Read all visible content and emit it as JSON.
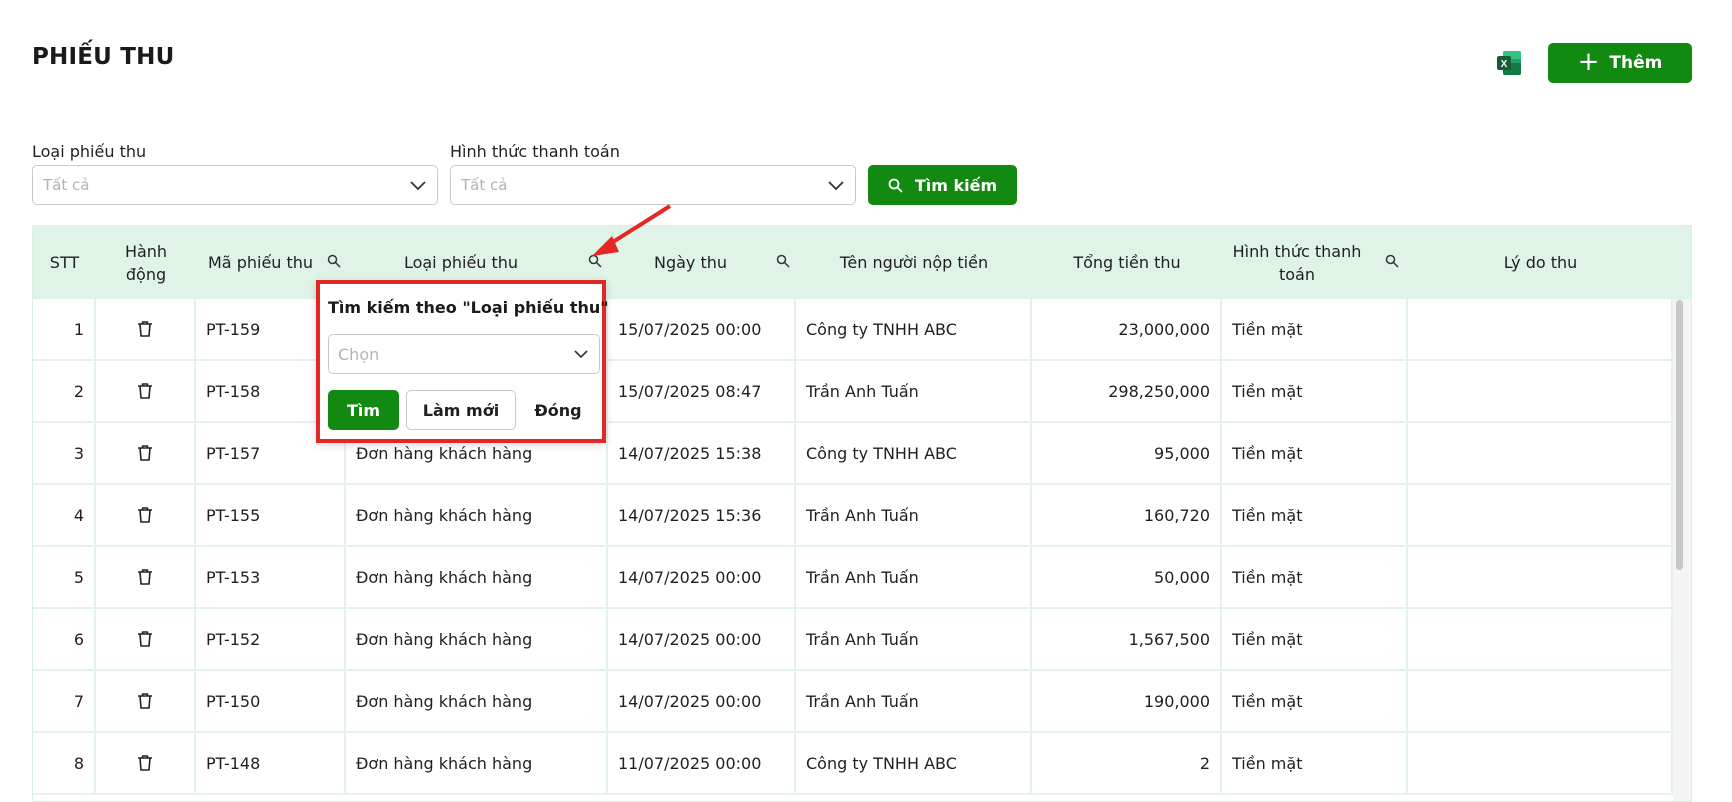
{
  "page": {
    "title": "PHIẾU THU"
  },
  "toolbar": {
    "add_label": "Thêm",
    "excel_icon": "excel-icon"
  },
  "filters": {
    "type_label": "Loại phiếu thu",
    "type_placeholder": "Tất cả",
    "payment_label": "Hình thức thanh toán",
    "payment_placeholder": "Tất cả",
    "search_label": "Tìm kiếm"
  },
  "table": {
    "headers": {
      "stt": "STT",
      "action": "Hành động",
      "code": "Mã phiếu thu",
      "type": "Loại phiếu thu",
      "date": "Ngày thu",
      "payer": "Tên người nộp tiền",
      "total": "Tổng tiền thu",
      "payment": "Hình thức thanh toán",
      "reason": "Lý do thu"
    },
    "rows": [
      {
        "stt": "1",
        "code": "PT-159",
        "type": "",
        "date": "15/07/2025 00:00",
        "payer": "Công ty TNHH ABC",
        "total": "23,000,000",
        "payment": "Tiền mặt",
        "reason": ""
      },
      {
        "stt": "2",
        "code": "PT-158",
        "type": "",
        "date": "15/07/2025 08:47",
        "payer": "Trần Anh Tuấn",
        "total": "298,250,000",
        "payment": "Tiền mặt",
        "reason": ""
      },
      {
        "stt": "3",
        "code": "PT-157",
        "type": "Đơn hàng khách hàng",
        "date": "14/07/2025 15:38",
        "payer": "Công ty TNHH ABC",
        "total": "95,000",
        "payment": "Tiền mặt",
        "reason": ""
      },
      {
        "stt": "4",
        "code": "PT-155",
        "type": "Đơn hàng khách hàng",
        "date": "14/07/2025 15:36",
        "payer": "Trần Anh Tuấn",
        "total": "160,720",
        "payment": "Tiền mặt",
        "reason": ""
      },
      {
        "stt": "5",
        "code": "PT-153",
        "type": "Đơn hàng khách hàng",
        "date": "14/07/2025 00:00",
        "payer": "Trần Anh Tuấn",
        "total": "50,000",
        "payment": "Tiền mặt",
        "reason": ""
      },
      {
        "stt": "6",
        "code": "PT-152",
        "type": "Đơn hàng khách hàng",
        "date": "14/07/2025 00:00",
        "payer": "Trần Anh Tuấn",
        "total": "1,567,500",
        "payment": "Tiền mặt",
        "reason": ""
      },
      {
        "stt": "7",
        "code": "PT-150",
        "type": "Đơn hàng khách hàng",
        "date": "14/07/2025 00:00",
        "payer": "Trần Anh Tuấn",
        "total": "190,000",
        "payment": "Tiền mặt",
        "reason": ""
      },
      {
        "stt": "8",
        "code": "PT-148",
        "type": "Đơn hàng khách hàng",
        "date": "11/07/2025 00:00",
        "payer": "Công ty TNHH ABC",
        "total": "2",
        "payment": "Tiền mặt",
        "reason": ""
      }
    ]
  },
  "popup": {
    "title": "Tìm kiếm theo \"Loại phiếu thu\"",
    "placeholder": "Chọn",
    "find_label": "Tìm",
    "reset_label": "Làm mới",
    "close_label": "Đóng"
  },
  "colors": {
    "primary": "#128a12",
    "header_bg": "#dff3e7",
    "highlight": "#e32626"
  }
}
